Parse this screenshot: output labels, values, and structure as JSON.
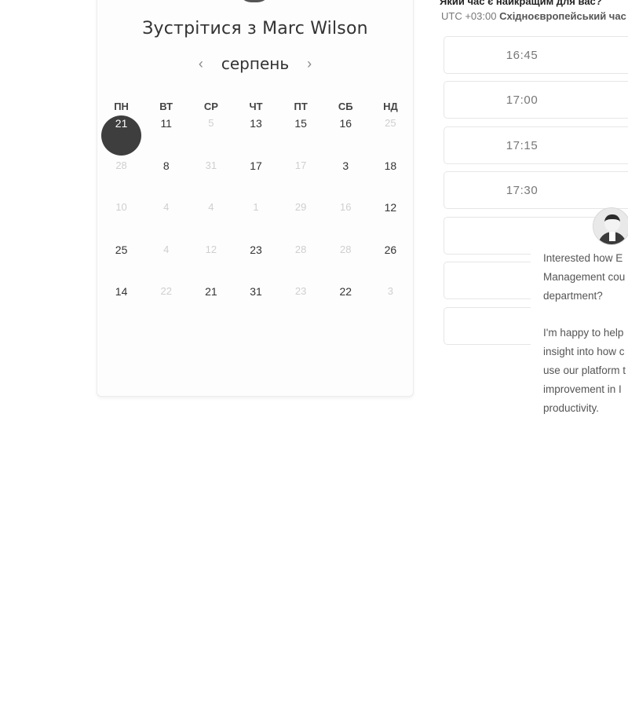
{
  "calendar": {
    "title": "Зустрітися з Marc Wilson",
    "month": "серпень",
    "prev_icon": "chevron-left-icon",
    "next_icon": "chevron-right-icon",
    "weekdays": [
      "ПН",
      "ВТ",
      "СР",
      "ЧТ",
      "ПТ",
      "СБ",
      "НД"
    ],
    "weeks": [
      [
        {
          "d": "21",
          "s": "selected"
        },
        {
          "d": "11",
          "s": "active"
        },
        {
          "d": "5",
          "s": "muted"
        },
        {
          "d": "13",
          "s": "active"
        },
        {
          "d": "15",
          "s": "active"
        },
        {
          "d": "16",
          "s": "active"
        },
        {
          "d": "25",
          "s": "muted"
        }
      ],
      [
        {
          "d": "28",
          "s": "muted"
        },
        {
          "d": "8",
          "s": "active"
        },
        {
          "d": "31",
          "s": "muted"
        },
        {
          "d": "17",
          "s": "active"
        },
        {
          "d": "17",
          "s": "muted"
        },
        {
          "d": "3",
          "s": "active"
        },
        {
          "d": "18",
          "s": "active"
        }
      ],
      [
        {
          "d": "10",
          "s": "muted"
        },
        {
          "d": "4",
          "s": "muted"
        },
        {
          "d": "4",
          "s": "muted"
        },
        {
          "d": "1",
          "s": "muted"
        },
        {
          "d": "29",
          "s": "muted"
        },
        {
          "d": "16",
          "s": "muted"
        },
        {
          "d": "12",
          "s": "active"
        }
      ],
      [
        {
          "d": "25",
          "s": "active"
        },
        {
          "d": "4",
          "s": "muted"
        },
        {
          "d": "12",
          "s": "muted"
        },
        {
          "d": "23",
          "s": "active"
        },
        {
          "d": "28",
          "s": "muted"
        },
        {
          "d": "28",
          "s": "muted"
        },
        {
          "d": "26",
          "s": "active"
        }
      ],
      [
        {
          "d": "14",
          "s": "active"
        },
        {
          "d": "22",
          "s": "muted"
        },
        {
          "d": "21",
          "s": "active"
        },
        {
          "d": "31",
          "s": "active"
        },
        {
          "d": "23",
          "s": "muted"
        },
        {
          "d": "22",
          "s": "active"
        },
        {
          "d": "3",
          "s": "muted"
        }
      ]
    ]
  },
  "time_panel": {
    "header": "Який час є найкращим для вас?",
    "timezone_offset": "UTC +03:00",
    "timezone_name": "Східноєвропейський час",
    "slots": [
      "16:45",
      "17:00",
      "17:15",
      "17:30",
      "",
      "",
      ""
    ]
  },
  "chat": {
    "paragraph_1_lines": [
      "Interested how E",
      "Management cou",
      "department?"
    ],
    "paragraph_2_lines": [
      "I'm happy to help",
      "insight into how c",
      "use our platform t",
      "improvement in I",
      "productivity."
    ]
  }
}
